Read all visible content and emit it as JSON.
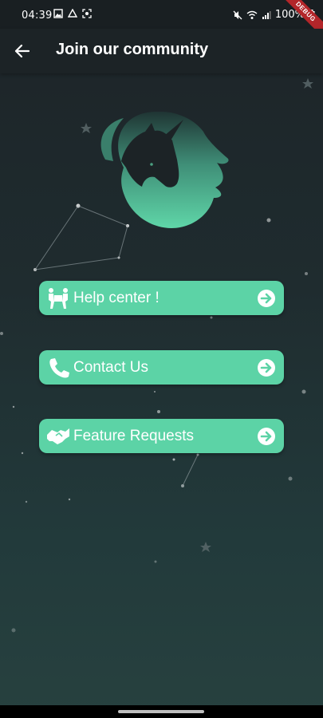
{
  "status_bar": {
    "time": "04:39",
    "battery": "100%",
    "debug_label": "DEBUG"
  },
  "header": {
    "title": "Join our community"
  },
  "menu": [
    {
      "label": "Help center !",
      "icon": "people-carry-icon"
    },
    {
      "label": "Contact Us",
      "icon": "phone-icon"
    },
    {
      "label": "Feature Requests",
      "icon": "handshake-icon"
    }
  ],
  "colors": {
    "accent": "#5cd3a6",
    "app_bar": "#1c2326",
    "background_top": "#1d2428",
    "background_bottom": "#27413f"
  }
}
